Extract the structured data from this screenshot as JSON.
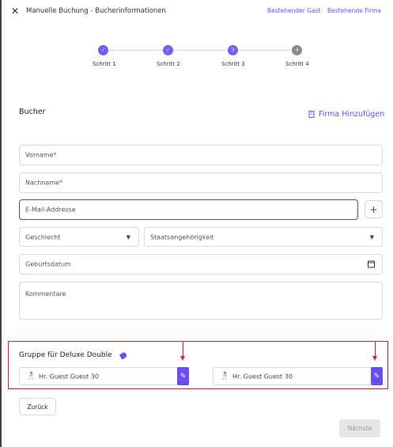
{
  "header": {
    "close_icon": "close-icon",
    "title": "Manuelle Buchung - Bucherinformationen",
    "link_existing_guest": "Bestehender Gast",
    "link_existing_firm": "Bestehende Firma"
  },
  "stepper": {
    "steps": [
      {
        "label": "Schritt 1",
        "state": "done",
        "mark": "✓"
      },
      {
        "label": "Schritt 2",
        "state": "done",
        "mark": "✓"
      },
      {
        "label": "Schritt 3",
        "state": "active",
        "mark": "3"
      },
      {
        "label": "Schritt 4",
        "state": "todo",
        "mark": "4"
      }
    ]
  },
  "booker": {
    "section_title": "Bucher",
    "add_firm_label": "Firma Hinzufügen",
    "fields": {
      "first_name": "Vorname",
      "last_name": "Nachname",
      "required_mark": "*",
      "email": "E-Mail-Addresse",
      "plus": "+",
      "gender": "Geschlecht",
      "nationality": "Staatsangehörigkeit",
      "birthdate": "Geburtsdatum",
      "comments": "Kommentare"
    }
  },
  "group": {
    "title": "Gruppe für Deluxe Double",
    "guests": [
      {
        "text": "Hr.  Guest  Guest  30"
      },
      {
        "text": "Hr.  Guest  Guest  30"
      }
    ]
  },
  "footer": {
    "back_label": "Zurück",
    "next_label": "Nächste"
  },
  "colors": {
    "accent": "#6b4ef0",
    "annotation": "#e02020",
    "step_todo": "#8a8a8a"
  }
}
